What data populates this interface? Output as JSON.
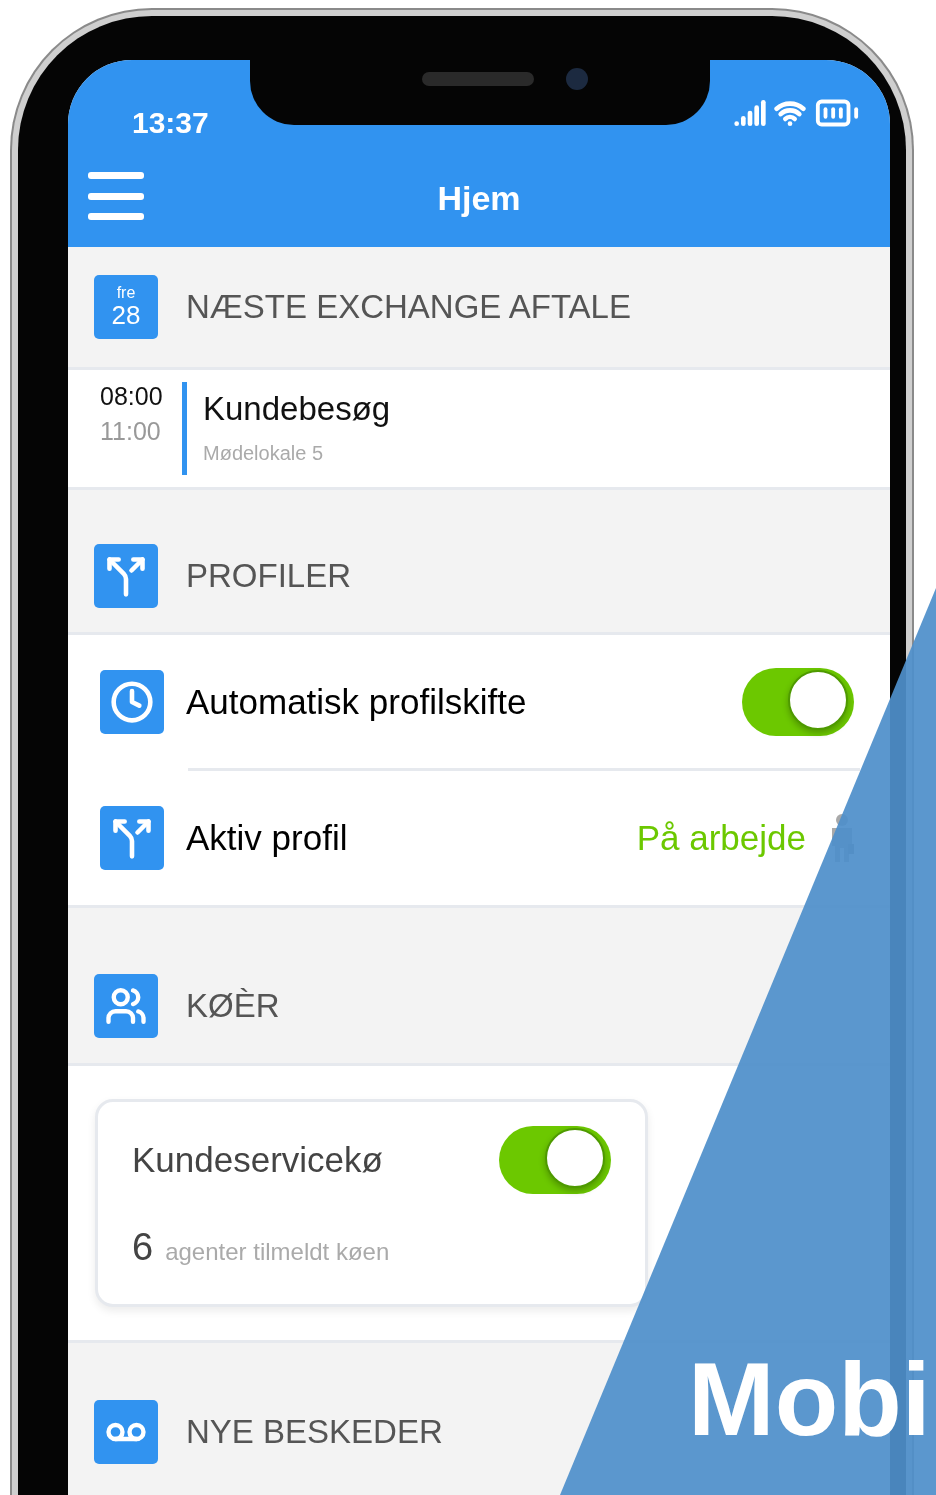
{
  "status_bar": {
    "time": "13:37"
  },
  "header": {
    "title": "Hjem"
  },
  "appointments": {
    "day": "fre",
    "date": "28",
    "title": "NÆSTE EXCHANGE AFTALE",
    "items": [
      {
        "start": "08:00",
        "end": "11:00",
        "title": "Kundebesøg",
        "location": "Mødelokale 5"
      }
    ]
  },
  "profiles": {
    "title": "PROFILER",
    "rows": [
      {
        "kind": "toggle",
        "label": "Automatisk profilskifte",
        "on": true
      },
      {
        "kind": "value",
        "label": "Aktiv profil",
        "value": "På arbejde"
      }
    ]
  },
  "queues": {
    "title": "KØÈR",
    "cards": [
      {
        "name": "Kundeservicekø",
        "on": true,
        "count": "6",
        "text": "agenter tilmeldt køen"
      }
    ]
  },
  "messages": {
    "title": "NYE BESKEDER"
  },
  "banner": {
    "text": "Mobi"
  }
}
